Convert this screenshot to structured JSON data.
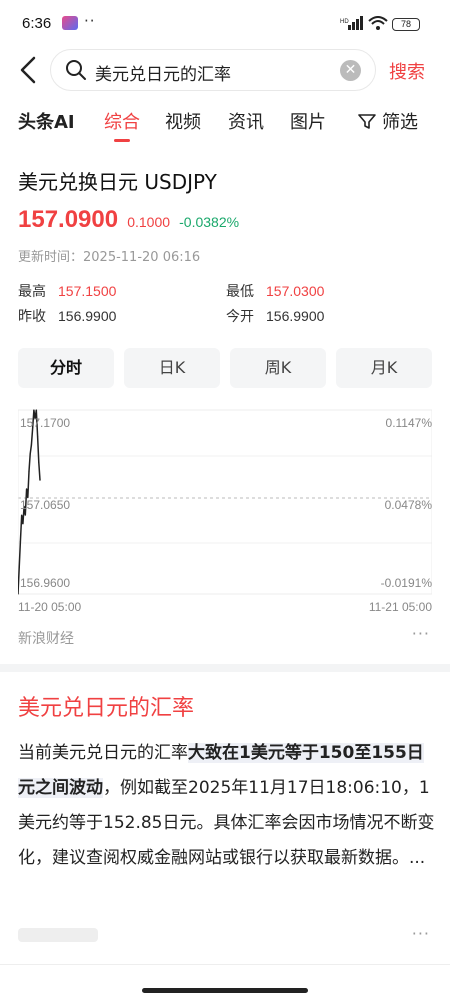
{
  "status": {
    "time": "6:36",
    "dots": "··",
    "battery": "78",
    "signal_label": "HD"
  },
  "search": {
    "query": "美元兑日元的汇率",
    "button": "搜索"
  },
  "tabs": [
    {
      "label": "头条AI"
    },
    {
      "label": "综合"
    },
    {
      "label": "视频"
    },
    {
      "label": "资讯"
    },
    {
      "label": "图片"
    },
    {
      "label": "筛选"
    }
  ],
  "active_tab": "综合",
  "quote": {
    "title": "美元兑换日元 USDJPY",
    "price": "157.0900",
    "change": "0.1000",
    "change_pct": "-0.0382%",
    "update_label": "更新时间：",
    "update_time": "2025-11-20 06:16",
    "high_label": "最高",
    "high": "157.1500",
    "low_label": "最低",
    "low": "157.0300",
    "prev_close_label": "昨收",
    "prev_close": "156.9900",
    "open_label": "今开",
    "open": "156.9900"
  },
  "period_tabs": [
    "分时",
    "日K",
    "周K",
    "月K"
  ],
  "colors": {
    "accent": "#f04142",
    "down": "#1aa86b",
    "muted": "#999999"
  },
  "chart_data": {
    "type": "line",
    "x_start": "11-20 05:00",
    "x_end": "11-21 05:00",
    "y_ticks": [
      "157.1700",
      "157.0650",
      "156.9600"
    ],
    "pct_ticks": [
      "0.1147%",
      "0.0478%",
      "-0.0191%"
    ],
    "ylim": [
      156.96,
      157.17
    ],
    "reference": 157.065,
    "series": [
      {
        "values": [
          156.96,
          156.99,
          157.02,
          157.05,
          157.04,
          157.06,
          157.05,
          157.08,
          157.07,
          157.1,
          157.12,
          157.13,
          157.15,
          157.17,
          157.16,
          157.17,
          157.14,
          157.11,
          157.09
        ]
      }
    ]
  },
  "chart_source": "新浪财经",
  "article": {
    "title": "美元兑日元的汇率",
    "body_pre": "当前美元兑日元的汇率",
    "body_bold": "大致在1美元等于150至155日元之间波动",
    "body_post": "，例如截至2025年11月17日18:06:10，1美元约等于152.85日元。具体汇率会因市场情况不断变化，建议查阅权威金融网站或银行以获取最新数据。..."
  },
  "more_label": "···"
}
